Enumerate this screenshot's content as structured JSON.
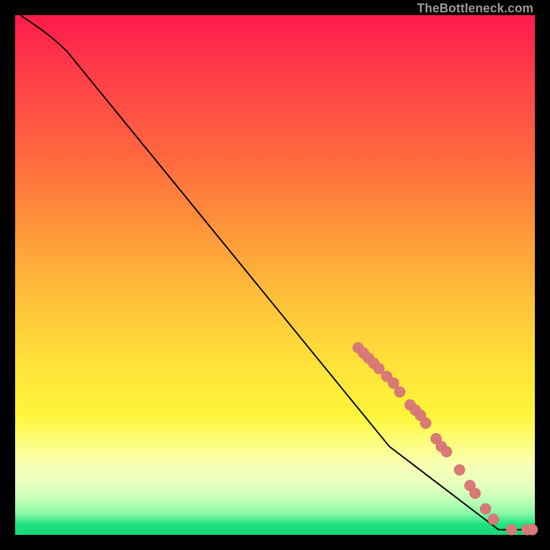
{
  "attribution": "TheBottleneck.com",
  "colors": {
    "background": "#000000",
    "curve": "#000000",
    "marker_fill": "#d97a78",
    "marker_stroke": "#c96967"
  },
  "chart_data": {
    "type": "line",
    "title": "",
    "xlabel": "",
    "ylabel": "",
    "xlim": [
      0,
      100
    ],
    "ylim": [
      0,
      100
    ],
    "curve": [
      {
        "x": 1,
        "y": 100
      },
      {
        "x": 4,
        "y": 98
      },
      {
        "x": 7,
        "y": 96
      },
      {
        "x": 10,
        "y": 93
      },
      {
        "x": 72,
        "y": 17
      },
      {
        "x": 93,
        "y": 1
      },
      {
        "x": 96,
        "y": 1
      },
      {
        "x": 99,
        "y": 1
      }
    ],
    "markers": [
      {
        "x": 66.0,
        "y": 36.0
      },
      {
        "x": 67.0,
        "y": 35.0
      },
      {
        "x": 68.0,
        "y": 34.0
      },
      {
        "x": 69.0,
        "y": 33.0
      },
      {
        "x": 70.0,
        "y": 32.0
      },
      {
        "x": 71.5,
        "y": 30.5
      },
      {
        "x": 72.8,
        "y": 29.2
      },
      {
        "x": 74.0,
        "y": 27.5
      },
      {
        "x": 76.0,
        "y": 25.0
      },
      {
        "x": 77.0,
        "y": 24.0
      },
      {
        "x": 78.0,
        "y": 23.0
      },
      {
        "x": 79.0,
        "y": 21.5
      },
      {
        "x": 81.0,
        "y": 18.5
      },
      {
        "x": 82.0,
        "y": 17.0
      },
      {
        "x": 83.0,
        "y": 16.0
      },
      {
        "x": 85.5,
        "y": 12.5
      },
      {
        "x": 87.5,
        "y": 9.5
      },
      {
        "x": 88.5,
        "y": 8.0
      },
      {
        "x": 90.5,
        "y": 5.0
      },
      {
        "x": 92.0,
        "y": 3.0
      },
      {
        "x": 95.5,
        "y": 1.0
      },
      {
        "x": 98.5,
        "y": 1.0
      },
      {
        "x": 99.5,
        "y": 1.0
      }
    ],
    "marker_radius": 8
  }
}
